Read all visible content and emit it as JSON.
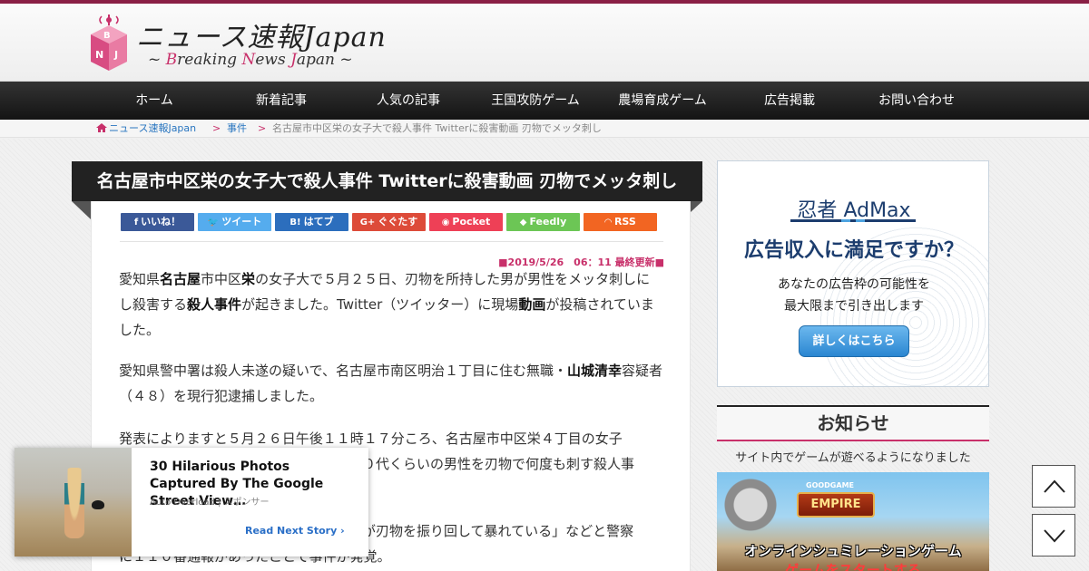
{
  "site": {
    "title": "ニュース速報Japan",
    "subtitle_prefix": "~ ",
    "subtitle_b": "B",
    "subtitle_reaking": "reaking ",
    "subtitle_n": "N",
    "subtitle_ews": "ews ",
    "subtitle_j": "J",
    "subtitle_apan": "apan ~",
    "logo_letters": [
      "B",
      "N",
      "J"
    ]
  },
  "nav": {
    "items": [
      {
        "label": "ホーム"
      },
      {
        "label": "新着記事"
      },
      {
        "label": "人気の記事"
      },
      {
        "label": "王国攻防ゲーム"
      },
      {
        "label": "農場育成ゲーム"
      },
      {
        "label": "広告掲載"
      },
      {
        "label": "お問い合わせ"
      }
    ]
  },
  "breadcrumb": {
    "home": "ニュース速報Japan",
    "separator": ">",
    "category": "事件",
    "current": "名古屋市中区栄の女子大で殺人事件 Twitterに殺害動画 刃物でメッタ刺し"
  },
  "article": {
    "title": "名古屋市中区栄の女子大で殺人事件 Twitterに殺害動画 刃物でメッタ刺し",
    "updated": "■2019/5/26　06：11 最終更新■",
    "share": [
      {
        "label": "いいね！",
        "icon": "f",
        "color": "#3b5998"
      },
      {
        "label": "ツイート",
        "icon": "🐦",
        "color": "#55acee"
      },
      {
        "label": "はてブ",
        "icon": "B!",
        "color": "#2c6ebd"
      },
      {
        "label": "ぐぐたす",
        "icon": "G+",
        "color": "#dd4b39"
      },
      {
        "label": "Pocket",
        "icon": "◉",
        "color": "#ee4056"
      },
      {
        "label": "Feedly",
        "icon": "◆",
        "color": "#6cc655"
      },
      {
        "label": "RSS",
        "icon": "◠",
        "color": "#f26522"
      }
    ],
    "p1": {
      "a": "愛知県",
      "b": "名古屋",
      "c": "市中区",
      "d": "栄",
      "e": "の女子大で５月２５日、刃物を所持した男が男性をメッタ刺しにし殺害する",
      "f": "殺人事件",
      "g": "が起きました。Twitter（ツイッター）に現場",
      "h": "動画",
      "i": "が投稿されていました。"
    },
    "p2": {
      "a": "愛知県警中署は殺人未遂の疑いで、名古屋市南区明治１丁目に住む無職・",
      "b": "山城清幸",
      "c": "容疑者（４８）を現行犯逮捕しました。"
    },
    "p3": {
      "a": "発表によりますと５月２６日午後１１時１７分ころ、名古屋市中区栄４丁目の女子",
      "b": "０代くらいの男性を刃物で何度も刺す殺人事"
    },
    "p4": {
      "a": "が刃物を振り回して暴れている」などと警察",
      "b": "に１１０番通報があったことで事件が発覚。"
    }
  },
  "sidebar": {
    "ad": {
      "brand_a": "忍者",
      "brand_b": "AdMax",
      "headline": "広告収入に満足ですか？",
      "line1": "あなたの広告枠の可能性を",
      "line2": "最大限まで引き出します",
      "button": "詳しくはこちら"
    },
    "notice": {
      "heading": "お知らせ",
      "text": "サイト内でゲームが遊べるようになりました"
    },
    "game": {
      "logo_top": "GOODGAME",
      "logo": "EMPIRE",
      "text": "オンラインシュミレーションゲーム",
      "cta": "ゲームをスタートする"
    }
  },
  "recommend": {
    "title": "30 Hilarious Photos Captured By The Google Street View…",
    "source": "Auto Overload",
    "sponsor": "スポンサー",
    "next": "Read Next Story"
  }
}
